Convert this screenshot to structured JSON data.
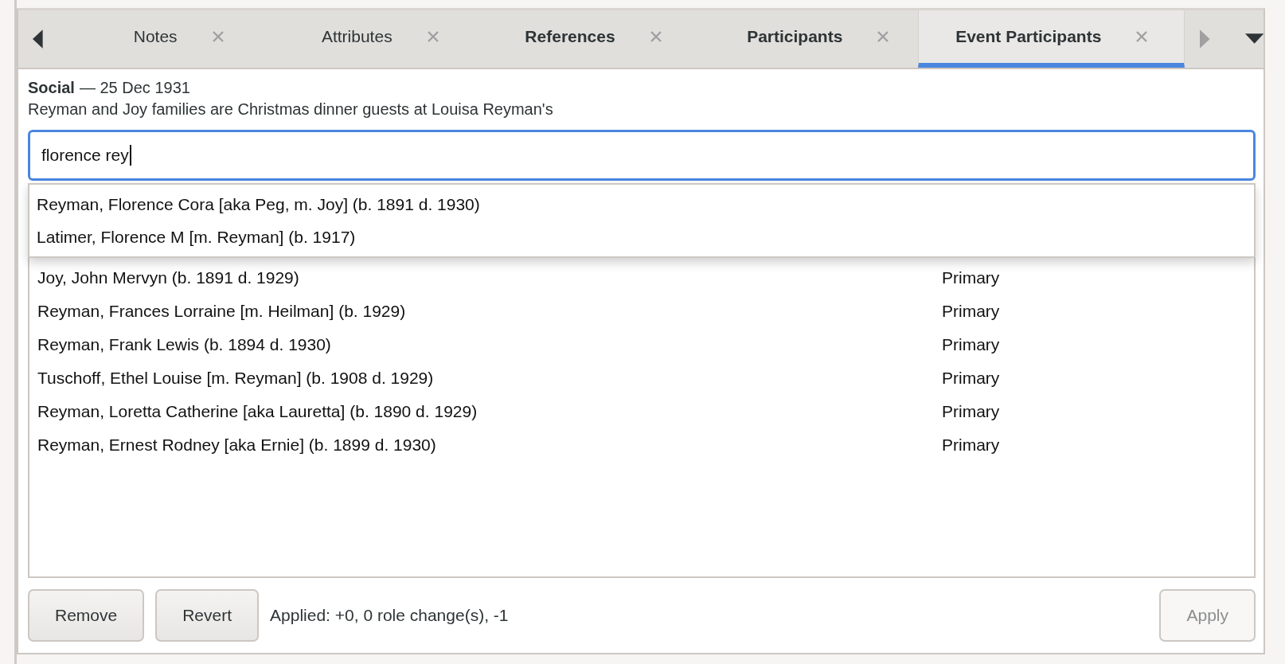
{
  "tab_bar": {
    "scroll_left": {
      "disabled": false
    },
    "scroll_right": {
      "disabled": true
    },
    "tabs": [
      {
        "label": "Notes",
        "emphasized": false,
        "selected": false
      },
      {
        "label": "Attributes",
        "emphasized": false,
        "selected": false
      },
      {
        "label": "References",
        "emphasized": true,
        "selected": false
      },
      {
        "label": "Participants",
        "emphasized": true,
        "selected": false
      },
      {
        "label": "Event Participants",
        "emphasized": true,
        "selected": true
      }
    ]
  },
  "event": {
    "type": "Social",
    "date": "— 25 Dec 1931",
    "description": "Reyman and Joy families are Christmas dinner guests at Louisa Reyman's"
  },
  "search": {
    "value": "florence rey"
  },
  "suggestions": [
    {
      "text": "Reyman, Florence Cora [aka Peg, m. Joy] (b. 1891 d. 1930)"
    },
    {
      "text": "Latimer, Florence M [m. Reyman] (b. 1917)"
    }
  ],
  "participants": [
    {
      "name": "Joy, John Mervyn (b. 1891 d. 1929)",
      "role": "Primary"
    },
    {
      "name": "Reyman, Frances Lorraine [m. Heilman] (b. 1929)",
      "role": "Primary"
    },
    {
      "name": "Reyman, Frank Lewis (b. 1894 d. 1930)",
      "role": "Primary"
    },
    {
      "name": "Tuschoff, Ethel Louise [m. Reyman] (b. 1908 d. 1929)",
      "role": "Primary"
    },
    {
      "name": "Reyman, Loretta Catherine [aka Lauretta] (b. 1890 d. 1929)",
      "role": "Primary"
    },
    {
      "name": "Reyman, Ernest Rodney [aka Ernie] (b. 1899 d. 1930)",
      "role": "Primary"
    }
  ],
  "buttons": [
    {
      "label": "Remove",
      "disabled": false
    },
    {
      "label": "Revert",
      "disabled": false
    }
  ],
  "status": "Applied: +0, 0 role change(s), -1",
  "apply_button": {
    "label": "Apply",
    "disabled": true
  }
}
